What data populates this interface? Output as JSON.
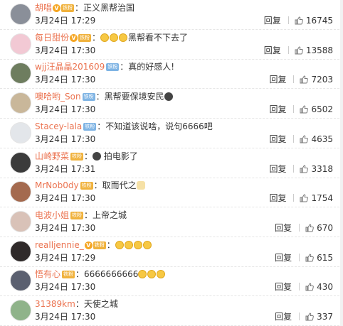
{
  "reply_label": "回复",
  "comments": [
    {
      "name": "胡唱",
      "badges": [
        "v",
        "fan"
      ],
      "text": "：正义黑帮治国",
      "emoji": [],
      "time": "3月24日 17:29",
      "likes": "16745",
      "avatar_color": "#8a8f99"
    },
    {
      "name": "每日甜份",
      "badges": [
        "v",
        "fan"
      ],
      "text": "：",
      "emoji": [
        "laugh",
        "laugh",
        "laugh"
      ],
      "text_after": "黑帮看不下去了",
      "time": "3月24日 17:30",
      "likes": "13588",
      "avatar_color": "#f2c9d4"
    },
    {
      "name": "wjj汪晶晶201609",
      "badges": [
        "iron"
      ],
      "text": "：真的好感人!",
      "emoji": [],
      "time": "3月24日 17:30",
      "likes": "7203",
      "avatar_color": "#6e7d5f"
    },
    {
      "name": "噢哈哟_Son",
      "badges": [
        "iron"
      ],
      "text": "：黑帮要保境安民",
      "emoji": [
        "dark"
      ],
      "time": "3月24日 17:30",
      "likes": "6502",
      "avatar_color": "#c9b79a"
    },
    {
      "name": "Stacey-lala",
      "badges": [
        "iron"
      ],
      "text": "：不知道该说啥，说句6666吧",
      "emoji": [],
      "time": "3月24日 17:30",
      "likes": "4635",
      "avatar_color": "#e3e6ea"
    },
    {
      "name": "山崎野菜",
      "badges": [
        "fan"
      ],
      "text": "：",
      "emoji": [
        "dark"
      ],
      "text_after": " 拍电影了",
      "time": "3月24日 17:31",
      "likes": "3318",
      "avatar_color": "#3b3b3b"
    },
    {
      "name": "MrNob0dy",
      "badges": [
        "fan"
      ],
      "text": "：取而代之",
      "emoji": [
        "cat"
      ],
      "time": "3月24日 17:30",
      "likes": "1754",
      "avatar_color": "#a46a4f"
    },
    {
      "name": "电波小姐",
      "badges": [
        "fan"
      ],
      "text": "：上帝之城",
      "emoji": [],
      "time": "3月24日 17:30",
      "likes": "670",
      "avatar_color": "#d9c2b8"
    },
    {
      "name": "realljennie_",
      "badges": [
        "v",
        "fan"
      ],
      "text": "：",
      "emoji": [
        "laugh",
        "laugh",
        "laugh",
        "laugh"
      ],
      "time": "3月24日 17:29",
      "likes": "615",
      "avatar_color": "#2f2a2a"
    },
    {
      "name": "悟有心",
      "badges": [
        "fan"
      ],
      "text": "：6666666666",
      "emoji": [
        "laugh",
        "laugh",
        "laugh"
      ],
      "time": "3月24日 17:30",
      "likes": "430",
      "avatar_color": "#5b6070"
    },
    {
      "name": "31389km",
      "badges": [],
      "text": "：天使之城",
      "emoji": [],
      "time": "3月24日 17:30",
      "likes": "337",
      "avatar_color": "#8fb38a"
    }
  ]
}
